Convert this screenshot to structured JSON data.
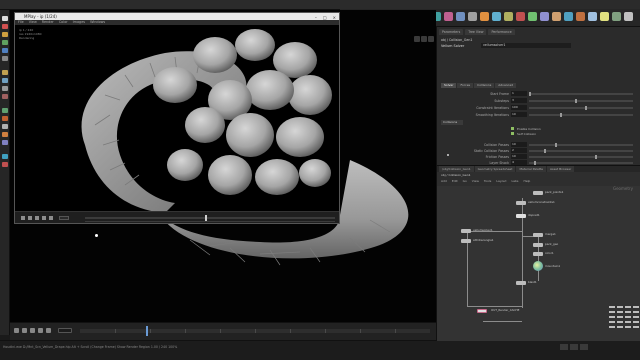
{
  "mplay": {
    "title": "MPlay - ip (1/24)",
    "menu": [
      "File",
      "View",
      "Render",
      "Color",
      "Images",
      "Windows"
    ],
    "info": [
      "ip 1 / 240",
      "res 1920x1080",
      "Rendering"
    ]
  },
  "params": {
    "tabs": [
      "Parameters",
      "Tree View",
      "Performance"
    ],
    "path": "obj / Collision_Gen1",
    "node_type": "Vellum Solver",
    "node_name": "vellumsolver1",
    "subtabs": [
      "Solver",
      "Forces",
      "Collisions",
      "Advanced"
    ],
    "rows": [
      {
        "label": "Start Frame",
        "value": "1",
        "frac": 0.0
      },
      {
        "label": "Substeps",
        "value": "3",
        "frac": 0.45
      },
      {
        "label": "Constraint Iterations",
        "value": "100",
        "frac": 0.55
      },
      {
        "label": "Smoothing Iterations",
        "value": "10",
        "frac": 0.3
      }
    ],
    "section_label": "Collisions",
    "checks": [
      "Enable Collision",
      "Self Collision"
    ],
    "rows2": [
      {
        "label": "Collision Passes",
        "value": "10",
        "frac": 0.25
      },
      {
        "label": "Static Collision Passes",
        "value": "2",
        "frac": 0.15
      },
      {
        "label": "Friction Passes",
        "value": "10",
        "frac": 0.65
      },
      {
        "label": "Layer Shock",
        "value": "4",
        "frac": 0.05
      }
    ]
  },
  "network": {
    "tabs": [
      "/obj/Collision_Gen1",
      "Geometry Spreadsheet",
      "Material Palette",
      "Asset Browser"
    ],
    "path": "obj / Collision_Gen1",
    "menu": [
      "Add",
      "Edit",
      "Go",
      "View",
      "Tools",
      "Layout",
      "Labs",
      "Help"
    ],
    "brand": "Geometry",
    "nodes": [
      {
        "label": "pack_points1"
      },
      {
        "label": "vellumconstraints1"
      },
      {
        "label": "dopnet1"
      },
      {
        "label": "vellumsolver1"
      },
      {
        "label": "attribwrangle1"
      },
      {
        "label": "merge1"
      },
      {
        "label": "pack_geo"
      },
      {
        "label": "color1"
      },
      {
        "label": "mountain1"
      },
      {
        "label": "blast1"
      },
      {
        "label": "OUT_Render_CACHE"
      }
    ]
  },
  "status": {
    "text": "Houdini.exe D:/Mnt_Scn_Vellum_Drape.hip  Alt + Scroll (Change Frame)  Show Render Region  1.00 / 240  100%"
  },
  "colors": {
    "accent": "#6a9bd6",
    "node_default": "#bdbdbd",
    "node_selected": "#e0e0e0",
    "check": "#8fbf63"
  }
}
